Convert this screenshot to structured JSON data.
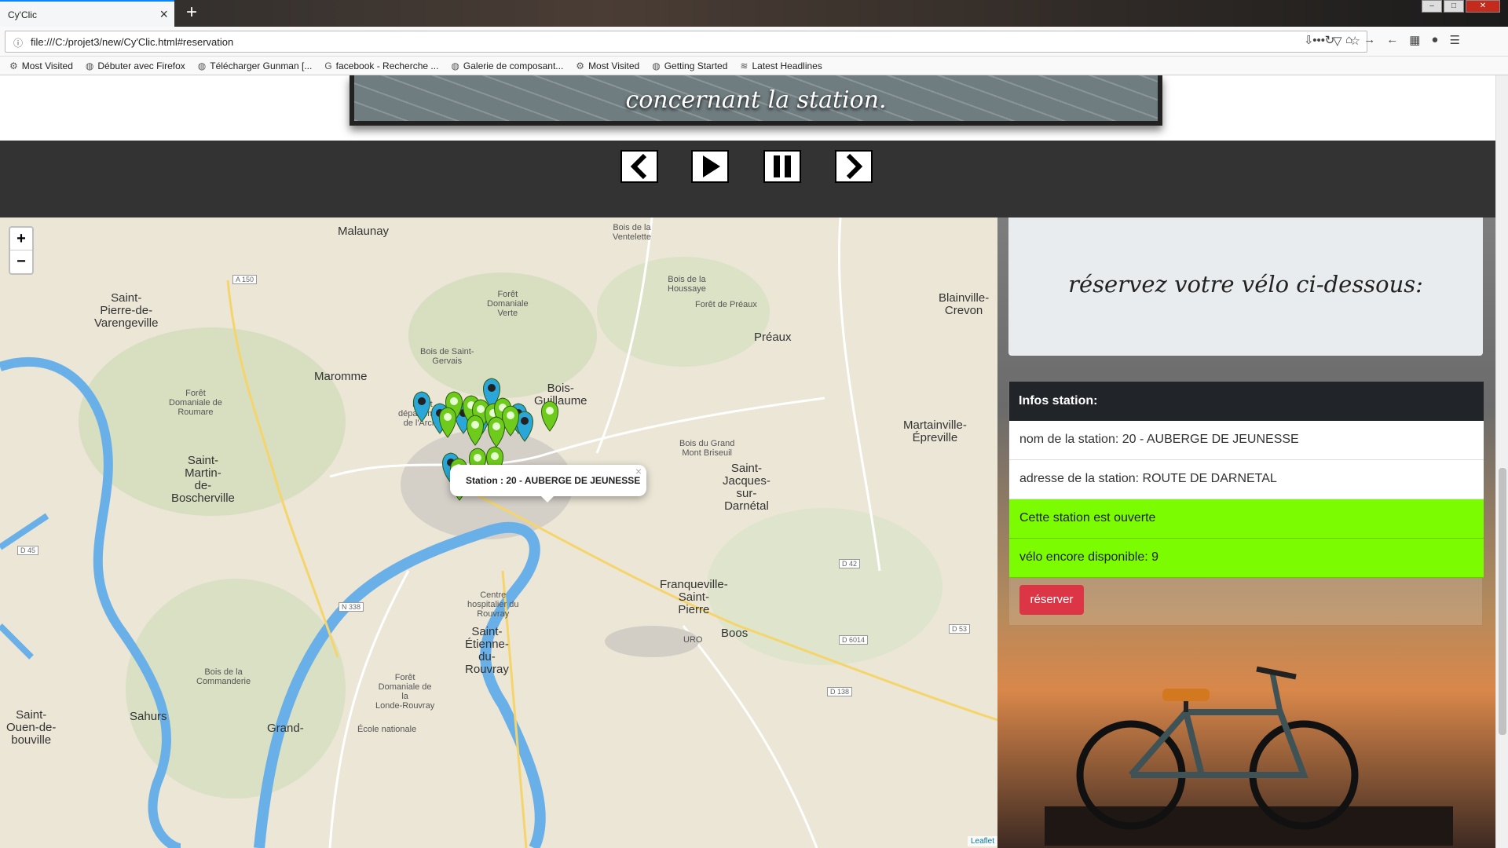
{
  "browser": {
    "tab_title": "Cy'Clic",
    "url": "file:///C:/projet3/new/Cy'Clic.html#reservation",
    "bookmarks": [
      {
        "label": "Most Visited",
        "icon": "gear-icon"
      },
      {
        "label": "Débuter avec Firefox",
        "icon": "globe-icon"
      },
      {
        "label": "Télécharger Gunman [...",
        "icon": "globe-icon"
      },
      {
        "label": "facebook - Recherche ...",
        "icon": "google-icon"
      },
      {
        "label": "Galerie de composant...",
        "icon": "globe-icon"
      },
      {
        "label": "Most Visited",
        "icon": "gear-icon"
      },
      {
        "label": "Getting Started",
        "icon": "globe-icon"
      },
      {
        "label": "Latest Headlines",
        "icon": "rss-icon"
      }
    ]
  },
  "slideshow": {
    "caption": "concernant la station."
  },
  "map": {
    "popup": "Station : 20 - AUBERGE DE JEUNESSE",
    "attribution": "Leaflet",
    "places": [
      {
        "name": "Malaunay"
      },
      {
        "name": "Maromme"
      },
      {
        "name": "Bois-\nGuillaume"
      },
      {
        "name": "Préaux"
      },
      {
        "name": "Saint-\nPierre-de-\nVarengeville"
      },
      {
        "name": "Blainville-\nCrevon"
      },
      {
        "name": "Saint-\nMartin-\nde-\nBoscherville"
      },
      {
        "name": "Saint-\nJacques-\nsur-\nDarnétal"
      },
      {
        "name": "Martainville-\nÉpreville"
      },
      {
        "name": "Franqueville-\nSaint-\nPierre"
      },
      {
        "name": "Saint-\nÉtienne-\ndu-\nRouvray"
      },
      {
        "name": "Boos"
      },
      {
        "name": "Sahurs"
      },
      {
        "name": "Saint-\nOuen-de-\nbouville"
      },
      {
        "name": "Grand-"
      },
      {
        "name": "Forêt\nDomaniale de\nRoumare"
      },
      {
        "name": "Forêt\nDomaniale\nVerte"
      },
      {
        "name": "Bois de Saint-\nGervais"
      },
      {
        "name": "Forêt de Préaux"
      },
      {
        "name": "Bois du Grand\nMont Briseuil"
      },
      {
        "name": "Centre\nhospitalier du\nRouvray"
      },
      {
        "name": "Bois de la\nCommanderie"
      },
      {
        "name": "École nationale"
      },
      {
        "name": "Bois de la\nVentelette"
      },
      {
        "name": "Bois de la\nHoussaye"
      },
      {
        "name": "Forêt\ndépartement\nde l'Arche"
      },
      {
        "name": "URO"
      },
      {
        "name": "Forêt\nDomaniale de\nla\nLonde-Rouvray"
      }
    ],
    "road_labels": [
      "A 150",
      "D 45",
      "N 338",
      "D 42",
      "D 53",
      "D 6014",
      "D 138"
    ],
    "markers": {
      "green_count": 14,
      "blue_count": 8,
      "green_color": "#6ecb1c",
      "blue_color": "#2aa7d8"
    }
  },
  "reservation": {
    "heading": "réservez votre vélo ci-dessous:",
    "card_title": "Infos station:",
    "station_name": "nom de la station: 20 - AUBERGE DE JEUNESSE",
    "station_address": "adresse de la station: ROUTE DE DARNETAL",
    "status": "Cette station est ouverte",
    "bikes_available": "vélo encore disponible: 9",
    "reserve_button": "réserver",
    "status_color": "#7cfc00",
    "button_color": "#dc3545"
  }
}
